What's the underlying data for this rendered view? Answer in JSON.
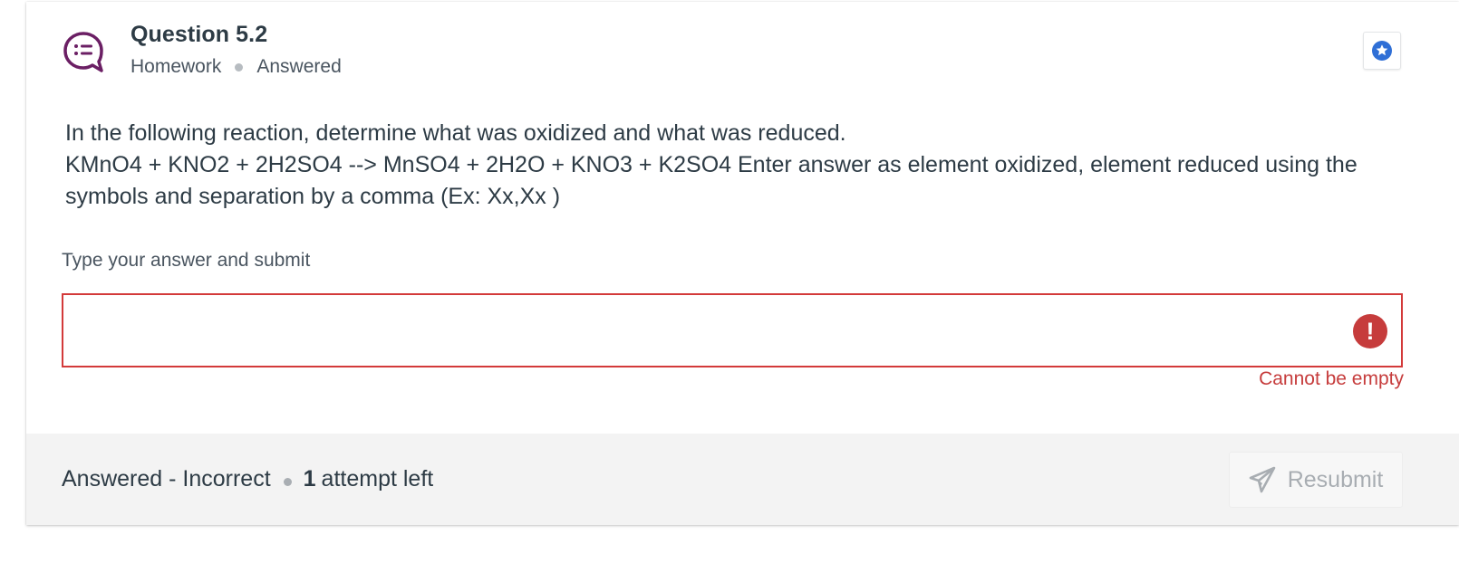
{
  "question": {
    "title": "Question 5.2",
    "type": "Homework",
    "status": "Answered",
    "body_line1": "In the following reaction, determine what was oxidized and what was reduced.",
    "body_line2": "KMnO4 + KNO2 + 2H2SO4 --> MnSO4 + 2H2O + KNO3 + K2SO4 Enter answer as element oxidized, element reduced using the symbols and separation by a comma (Ex: Xx,Xx )"
  },
  "answer": {
    "label": "Type your answer and submit",
    "value": "",
    "placeholder": "",
    "error_icon": "!",
    "error": "Cannot be empty"
  },
  "footer": {
    "status": "Answered - Incorrect",
    "attempts_count": "1",
    "attempts_text": "attempt left",
    "resubmit_label": "Resubmit"
  },
  "icons": {
    "question": "discussion-bubble-icon",
    "bookmark": "star-badge-icon",
    "error": "exclamation-icon",
    "send": "paper-plane-icon"
  },
  "colors": {
    "icon_purple": "#6b1f64",
    "bookmark_blue": "#2f6fd6",
    "error_red": "#c63c3c",
    "footer_bg": "#f3f3f3"
  }
}
